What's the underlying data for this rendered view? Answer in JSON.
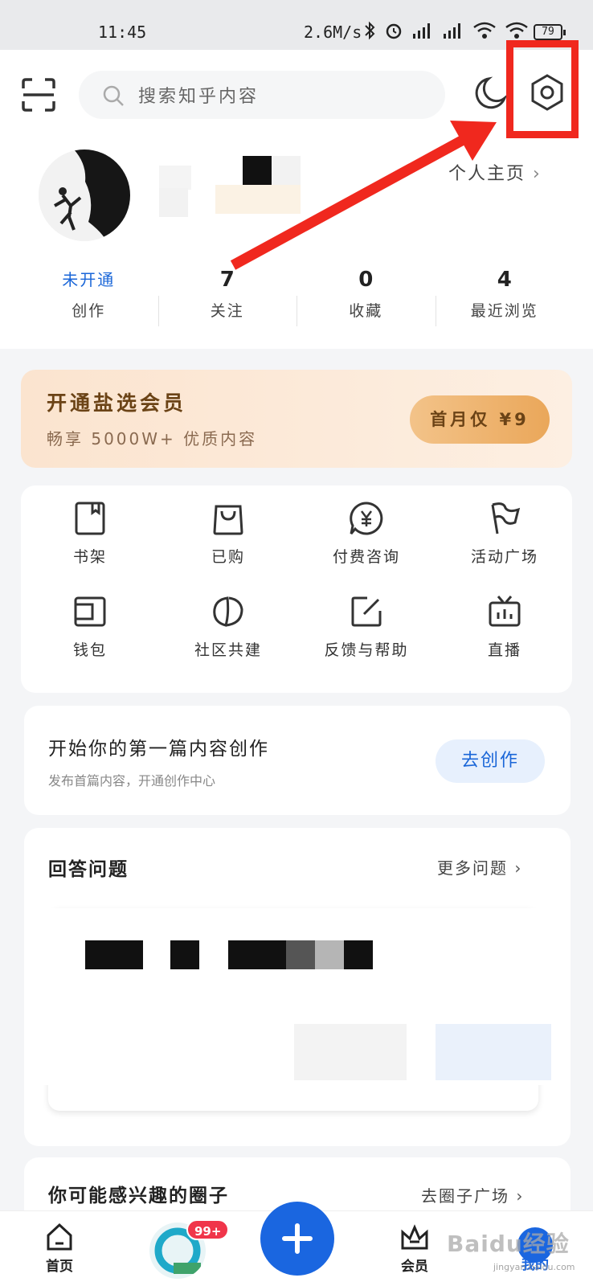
{
  "status_bar": {
    "time": "11:45",
    "speed": "2.6M/s",
    "battery": "79"
  },
  "search": {
    "placeholder": "搜索知乎内容"
  },
  "profile": {
    "homepage_link": "个人主页",
    "stats": [
      {
        "value": "未开通",
        "label": "创作"
      },
      {
        "value": "7",
        "label": "关注"
      },
      {
        "value": "0",
        "label": "收藏"
      },
      {
        "value": "4",
        "label": "最近浏览"
      }
    ]
  },
  "vip": {
    "title": "开通盐选会员",
    "subtitle": "畅享 5000W+ 优质内容",
    "button": "首月仅 ¥9"
  },
  "grid": {
    "items": [
      {
        "label": "书架",
        "icon": "bookshelf-icon"
      },
      {
        "label": "已购",
        "icon": "bag-icon"
      },
      {
        "label": "付费咨询",
        "icon": "yen-chat-icon"
      },
      {
        "label": "活动广场",
        "icon": "flag-icon"
      },
      {
        "label": "钱包",
        "icon": "wallet-icon"
      },
      {
        "label": "社区共建",
        "icon": "leaf-icon"
      },
      {
        "label": "反馈与帮助",
        "icon": "edit-icon"
      },
      {
        "label": "直播",
        "icon": "tv-icon"
      }
    ]
  },
  "create": {
    "title": "开始你的第一篇内容创作",
    "subtitle": "发布首篇内容，开通创作中心",
    "button": "去创作"
  },
  "answer": {
    "title": "回答问题",
    "more": "更多问题"
  },
  "circles": {
    "title": "你可能感兴趣的圈子",
    "more": "去圈子广场"
  },
  "tabbar": {
    "home": "首页",
    "badge": "99+",
    "vip": "会员",
    "me": "我的"
  },
  "watermark": {
    "main": "Baidu经验",
    "sub": "jingyan.baidu.com"
  },
  "colors": {
    "accent": "#1a66e0",
    "highlight": "#f0281e",
    "vip_text": "#6b4316"
  }
}
